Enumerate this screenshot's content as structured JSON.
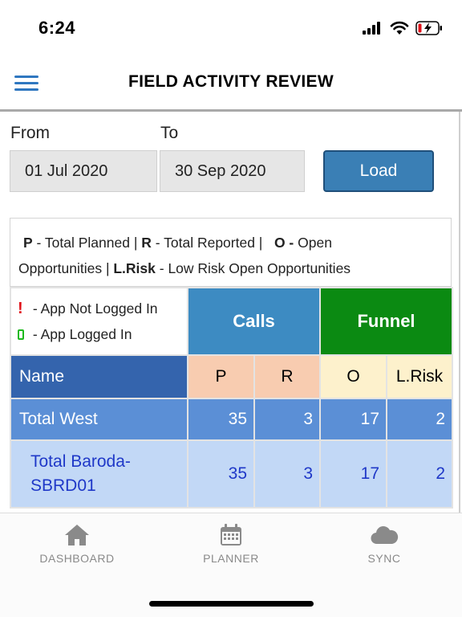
{
  "status": {
    "time": "6:24"
  },
  "header": {
    "title": "FIELD ACTIVITY REVIEW"
  },
  "filters": {
    "from_label": "From",
    "to_label": "To",
    "from_value": "01 Jul 2020",
    "to_value": "30 Sep 2020",
    "load_label": "Load"
  },
  "legend": {
    "p_key": "P",
    "p_text": " - Total Planned | ",
    "r_key": "R",
    "r_text": " - Total Reported | ",
    "o_key": "O -",
    "o_text": " Open",
    "o_text2": "Opportunities | ",
    "lrisk_key": "L.Risk",
    "lrisk_text": " - Low Risk Open Opportunities"
  },
  "app_legend": {
    "not_logged": " - App Not Logged In",
    "logged": " - App Logged In"
  },
  "table": {
    "group_calls": "Calls",
    "group_funnel": "Funnel",
    "columns": {
      "name": "Name",
      "p": "P",
      "r": "R",
      "o": "O",
      "lrisk": "L.Risk"
    },
    "rows": [
      {
        "name": "Total West",
        "p": "35",
        "r": "3",
        "o": "17",
        "lrisk": "2"
      },
      {
        "name_line1": "Total Baroda-",
        "name_line2": "SBRD01",
        "p": "35",
        "r": "3",
        "o": "17",
        "lrisk": "2"
      }
    ]
  },
  "tabs": [
    {
      "label": "DASHBOARD",
      "icon": "home-icon"
    },
    {
      "label": "PLANNER",
      "icon": "calendar-icon"
    },
    {
      "label": "SYNC",
      "icon": "cloud-icon"
    }
  ],
  "colors": {
    "calls": "#3d8bc2",
    "funnel": "#0b8a12",
    "name_header": "#3464ad",
    "total_row": "#5b8fd6",
    "sub_row": "#c2d8f6",
    "load_button": "#3a7fb5"
  }
}
